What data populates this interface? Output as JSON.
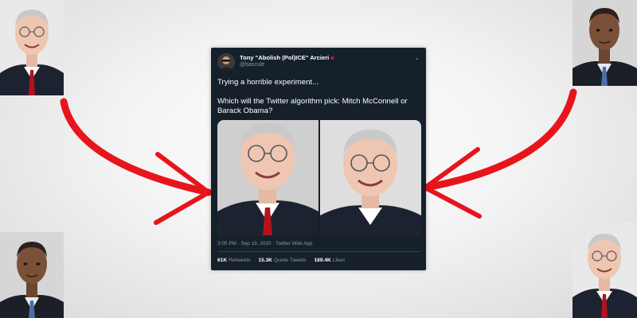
{
  "tweet": {
    "author_name": "Tony \"Abolish (Pol)ICE\" Arcieri",
    "author_badge_icon": "crab-icon",
    "handle": "@bascule",
    "text_line1": "Trying a horrible experiment...",
    "text_line2": "Which will the Twitter algorithm pick: Mitch McConnell or Barack Obama?",
    "timestamp": "3:05 PM · Sep 19, 2020 · Twitter Web App",
    "retweets_count": "61K",
    "retweets_label": "Retweets",
    "quote_count": "15.3K",
    "quote_label": "Quote Tweets",
    "likes_count": "189.4K",
    "likes_label": "Likes"
  },
  "colors": {
    "arrow": "#e8141c",
    "tweet_bg": "#15202b",
    "muted_text": "#8899a6"
  }
}
